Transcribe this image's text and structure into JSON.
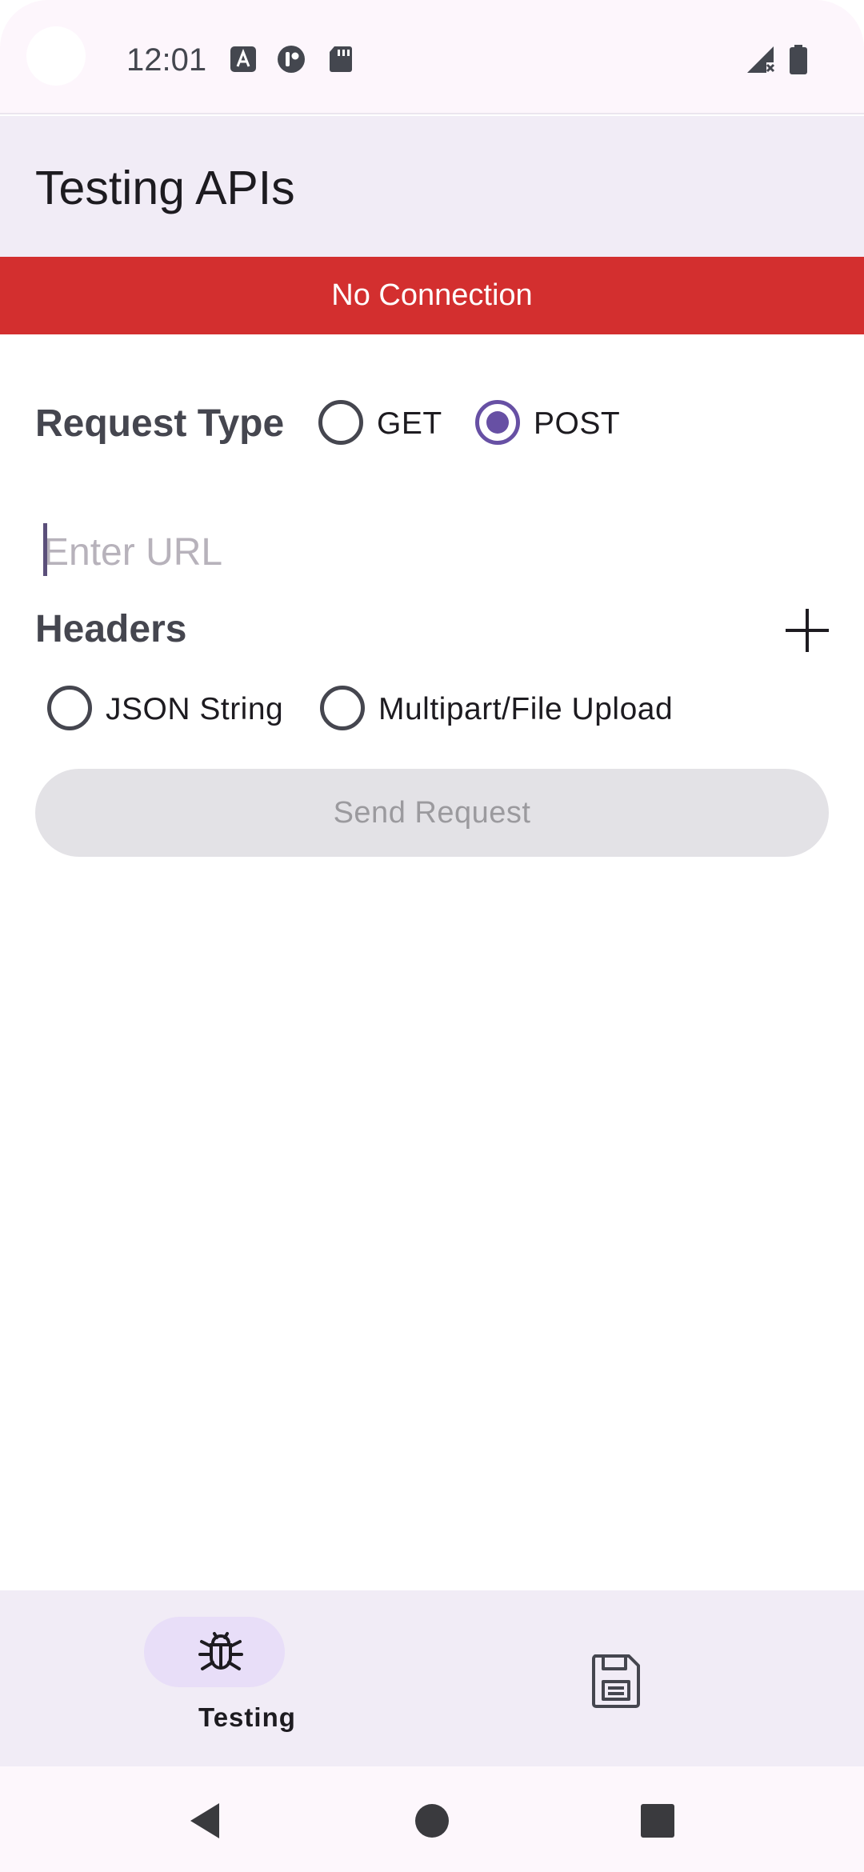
{
  "status_bar": {
    "time": "12:01",
    "icons": [
      "accessibility-a-icon",
      "teams-app-icon",
      "sd-card-icon",
      "no-signal-icon",
      "battery-icon"
    ]
  },
  "app_bar": {
    "title": "Testing APIs"
  },
  "banner": {
    "text": "No Connection",
    "color": "#d32f2f"
  },
  "request_type": {
    "label": "Request Type",
    "options": [
      {
        "label": "GET",
        "selected": false
      },
      {
        "label": "POST",
        "selected": true
      }
    ]
  },
  "url": {
    "placeholder": "Enter URL",
    "value": ""
  },
  "headers": {
    "label": "Headers",
    "add_icon": "plus-icon"
  },
  "body_type": {
    "options": [
      {
        "label": "JSON String",
        "selected": false
      },
      {
        "label": "Multipart/File Upload",
        "selected": false
      }
    ]
  },
  "send_button": {
    "label": "Send Request",
    "enabled": false
  },
  "bottom_nav": {
    "items": [
      {
        "label": "Testing",
        "icon": "bug-icon",
        "active": true
      },
      {
        "label": "",
        "icon": "save-icon",
        "active": false
      }
    ]
  },
  "system_nav": {
    "icons": [
      "back-icon",
      "home-icon",
      "recents-icon"
    ]
  },
  "colors": {
    "accent": "#6750a4",
    "surface_container": "#f1ecf6",
    "active_indicator": "#e8def8"
  }
}
